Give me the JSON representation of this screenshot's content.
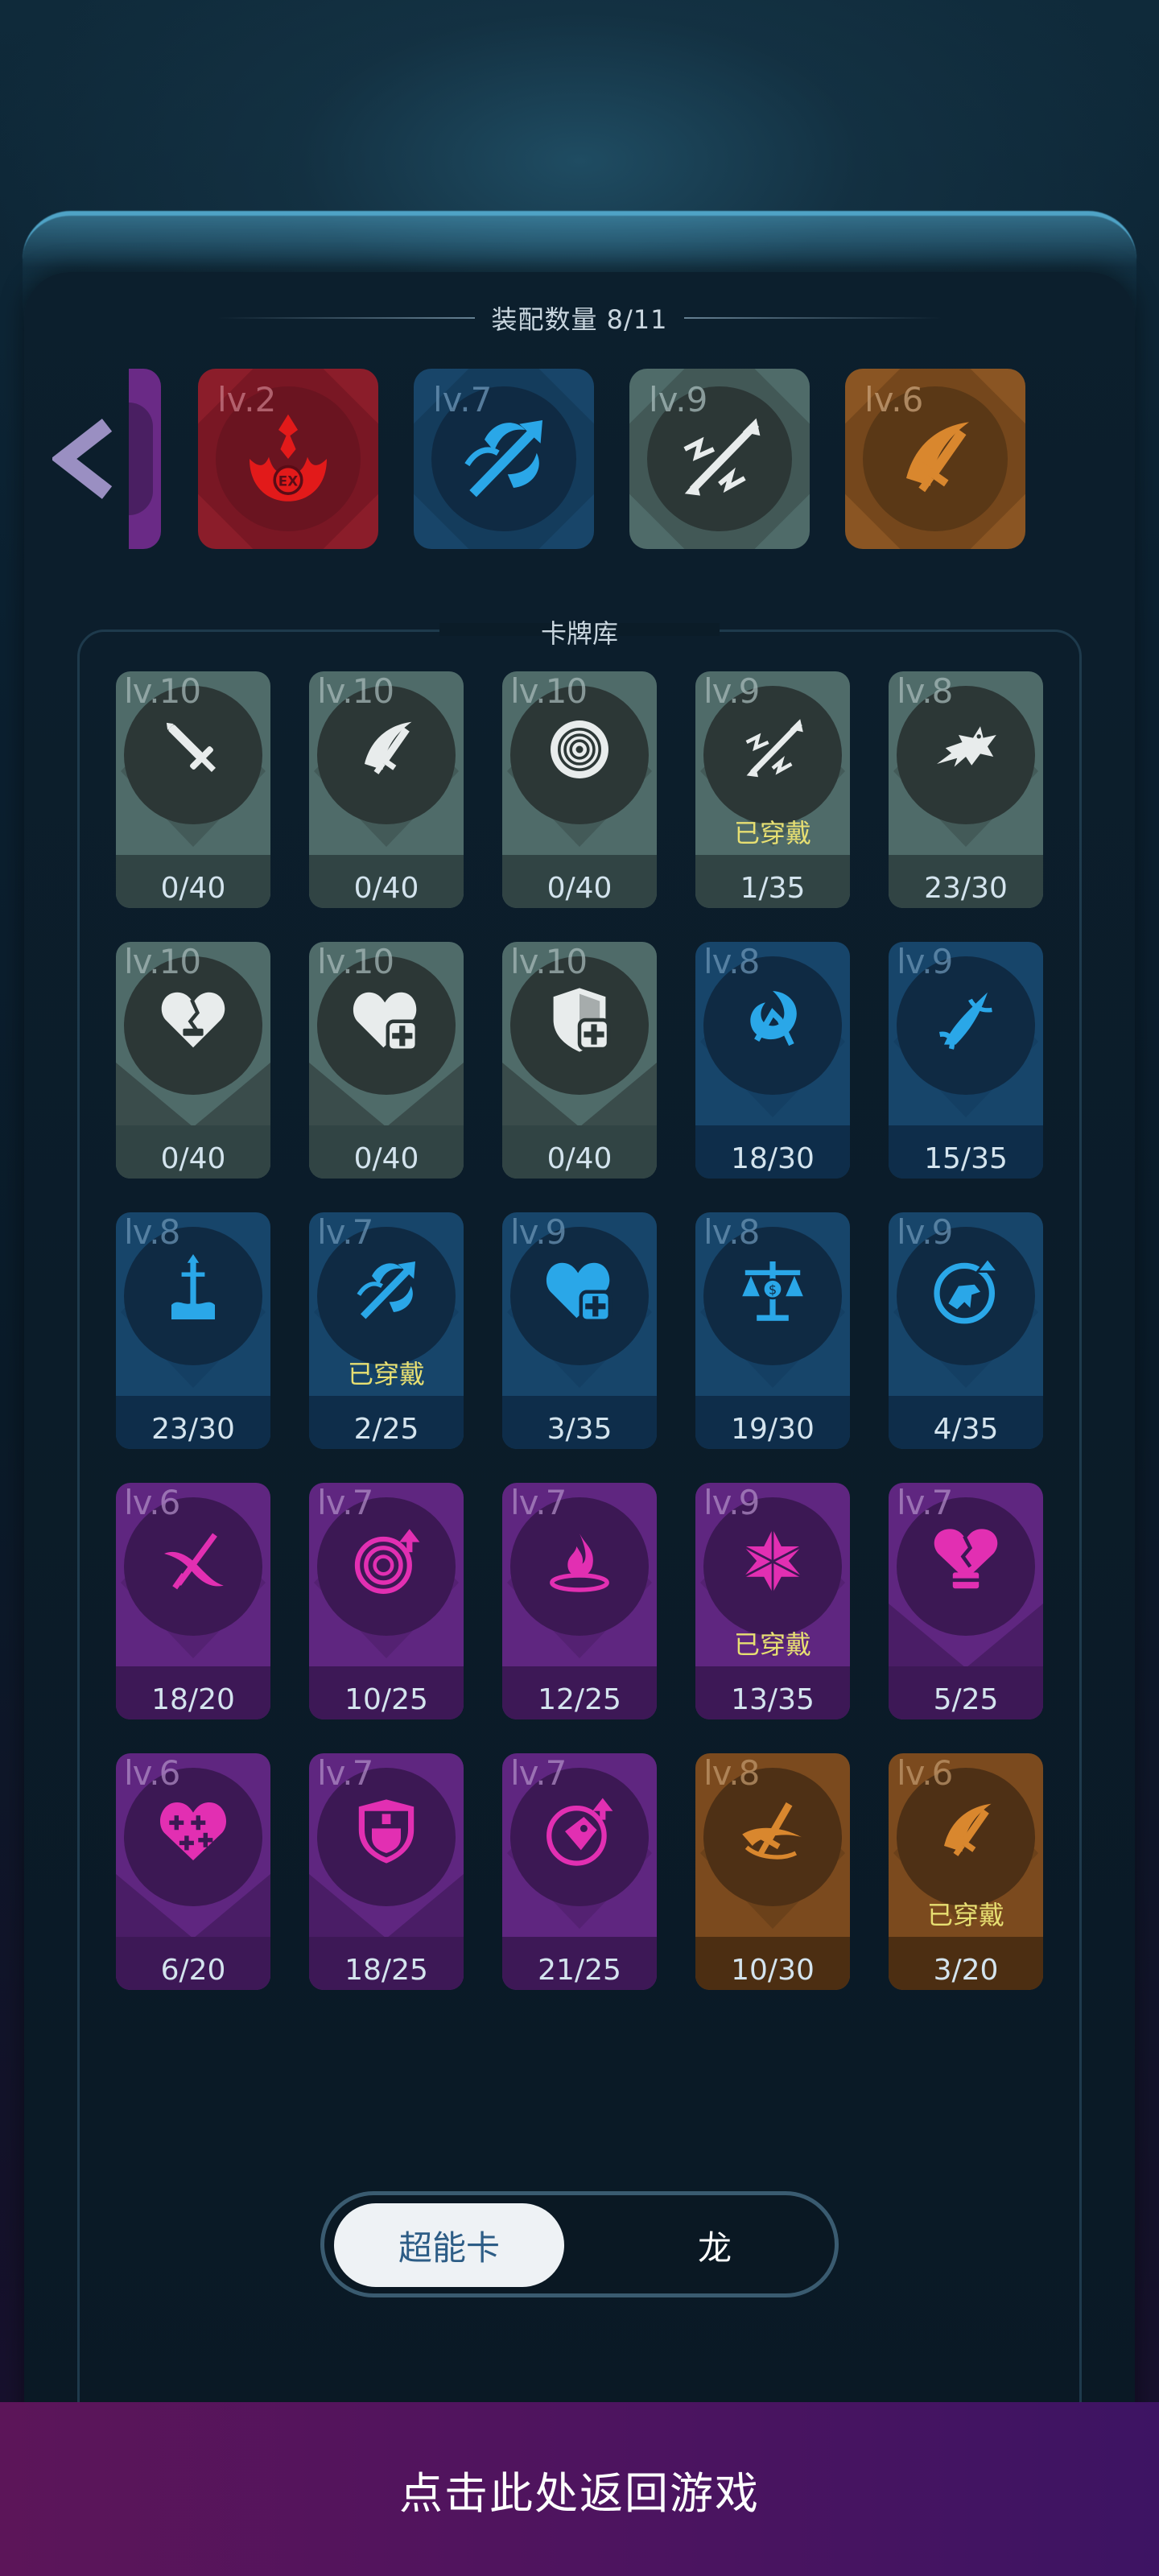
{
  "equip_section": {
    "title": "装配数量 8/11",
    "back_icon": "chevron-left-icon",
    "equipped": [
      {
        "level": "lv.2",
        "rarity": "red",
        "icon": "flame-ex-icon"
      },
      {
        "level": "lv.7",
        "rarity": "blue",
        "icon": "fire-arrow-icon"
      },
      {
        "level": "lv.9",
        "rarity": "gray",
        "icon": "lightning-arrow-icon"
      },
      {
        "level": "lv.6",
        "rarity": "orange",
        "icon": "sword-slash-icon"
      }
    ]
  },
  "library": {
    "title": "卡牌库",
    "worn_label": "已穿戴",
    "cards": [
      {
        "level": "lv.10",
        "count": "0/40",
        "rarity": "gray",
        "icon": "sword-icon",
        "worn": false
      },
      {
        "level": "lv.10",
        "count": "0/40",
        "rarity": "gray",
        "icon": "sword-slash-icon",
        "worn": false
      },
      {
        "level": "lv.10",
        "count": "0/40",
        "rarity": "gray",
        "icon": "target-rings-icon",
        "worn": false
      },
      {
        "level": "lv.9",
        "count": "1/35",
        "rarity": "gray",
        "icon": "lightning-arrow-icon",
        "worn": true
      },
      {
        "level": "lv.8",
        "count": "23/30",
        "rarity": "gray",
        "icon": "dragon-icon",
        "worn": false
      },
      {
        "level": "lv.10",
        "count": "0/40",
        "rarity": "gray",
        "icon": "heart-minus-icon",
        "worn": false
      },
      {
        "level": "lv.10",
        "count": "0/40",
        "rarity": "gray",
        "icon": "heart-plus-icon",
        "worn": false
      },
      {
        "level": "lv.10",
        "count": "0/40",
        "rarity": "gray",
        "icon": "shield-plus-icon",
        "worn": false
      },
      {
        "level": "lv.8",
        "count": "18/30",
        "rarity": "blue",
        "icon": "dragon-swirl-icon",
        "worn": false
      },
      {
        "level": "lv.9",
        "count": "15/35",
        "rarity": "blue",
        "icon": "flame-sword-icon",
        "worn": false
      },
      {
        "level": "lv.8",
        "count": "23/30",
        "rarity": "blue",
        "icon": "trident-splash-icon",
        "worn": false
      },
      {
        "level": "lv.7",
        "count": "2/25",
        "rarity": "blue",
        "icon": "fire-arrow-icon",
        "worn": true
      },
      {
        "level": "lv.9",
        "count": "3/35",
        "rarity": "blue",
        "icon": "heart-plus-icon",
        "worn": false
      },
      {
        "level": "lv.8",
        "count": "19/30",
        "rarity": "blue",
        "icon": "scale-dollar-icon",
        "worn": false
      },
      {
        "level": "lv.9",
        "count": "4/35",
        "rarity": "blue",
        "icon": "dino-up-icon",
        "worn": false
      },
      {
        "level": "lv.6",
        "count": "18/20",
        "rarity": "purple",
        "icon": "cross-swords-icon",
        "worn": false
      },
      {
        "level": "lv.7",
        "count": "10/25",
        "rarity": "purple",
        "icon": "target-up-icon",
        "worn": false
      },
      {
        "level": "lv.7",
        "count": "12/25",
        "rarity": "purple",
        "icon": "fire-pool-icon",
        "worn": false
      },
      {
        "level": "lv.9",
        "count": "13/35",
        "rarity": "purple",
        "icon": "hex-star-icon",
        "worn": true
      },
      {
        "level": "lv.7",
        "count": "5/25",
        "rarity": "purple",
        "icon": "heart-potion-icon",
        "worn": false
      },
      {
        "level": "lv.6",
        "count": "6/20",
        "rarity": "purple",
        "icon": "heart-multi-plus-icon",
        "worn": false
      },
      {
        "level": "lv.7",
        "count": "18/25",
        "rarity": "purple",
        "icon": "shield-potion-icon",
        "worn": false
      },
      {
        "level": "lv.7",
        "count": "21/25",
        "rarity": "purple",
        "icon": "tag-up-icon",
        "worn": false
      },
      {
        "level": "lv.8",
        "count": "10/30",
        "rarity": "orange",
        "icon": "sword-swirl-icon",
        "worn": false
      },
      {
        "level": "lv.6",
        "count": "3/20",
        "rarity": "orange",
        "icon": "sword-slash-icon",
        "worn": true
      }
    ]
  },
  "tabs": {
    "active": "超能卡",
    "inactive": "龙"
  },
  "footer": {
    "label": "点击此处返回游戏"
  },
  "colors": {
    "gray_icon": "#e8ecec",
    "blue_icon": "#2aa7e8",
    "purple_icon": "#e22fb2",
    "orange_icon": "#d9872e",
    "red_icon": "#e21a1a",
    "worn_text": "#e7df72"
  }
}
